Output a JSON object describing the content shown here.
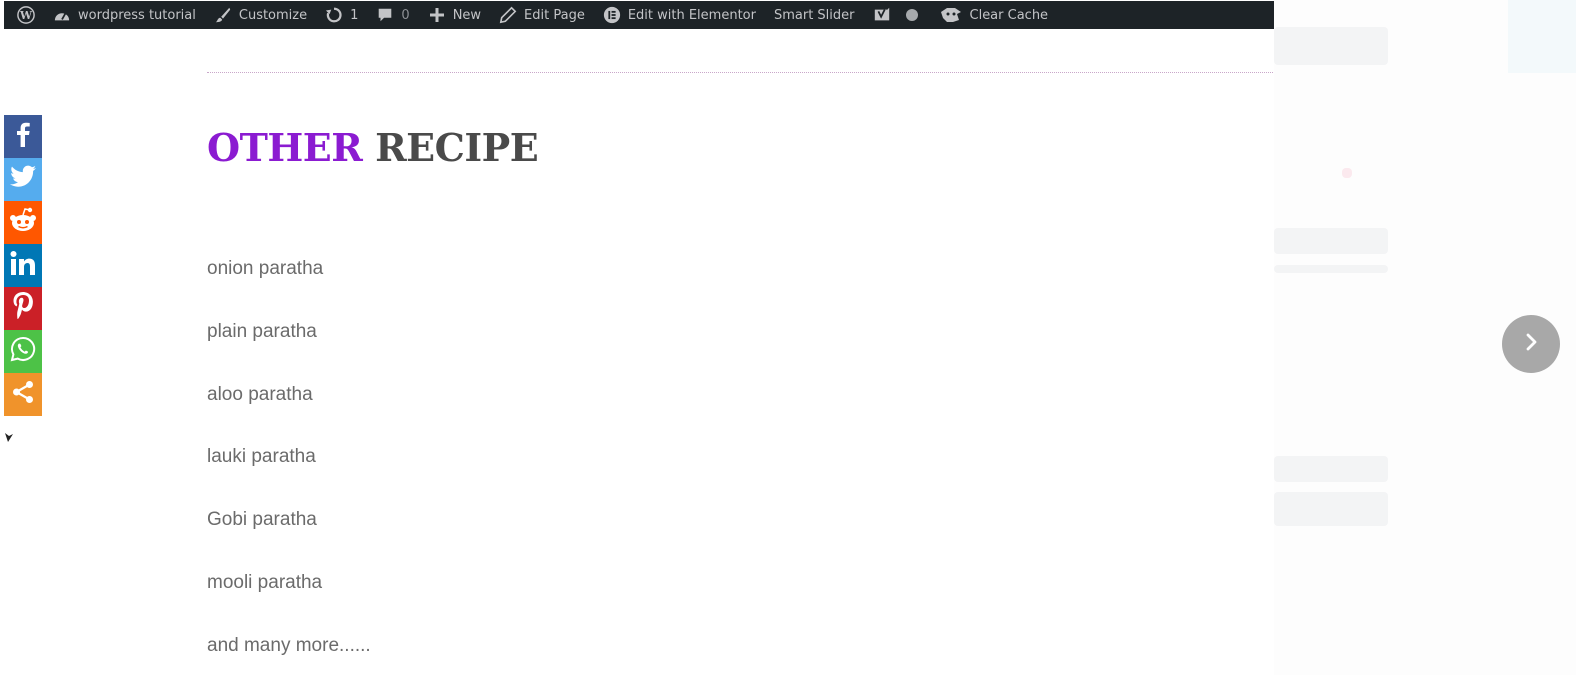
{
  "admin_bar": {
    "site_name": "wordpress tutorial",
    "customize": "Customize",
    "updates_count": "1",
    "comments_count": "0",
    "new": "New",
    "edit_page": "Edit Page",
    "edit_elementor": "Edit with Elementor",
    "smart_slider": "Smart Slider",
    "clear_cache": "Clear Cache"
  },
  "section": {
    "title_accent": "OTHER",
    "title_rest": "RECIPE"
  },
  "recipes": [
    "onion paratha",
    "plain paratha",
    "aloo paratha",
    "lauki paratha",
    "Gobi paratha",
    "mooli paratha",
    "and many more......"
  ],
  "share_buttons": [
    {
      "name": "facebook",
      "color": "#3b5998"
    },
    {
      "name": "twitter",
      "color": "#55acee"
    },
    {
      "name": "reddit",
      "color": "#ff5700"
    },
    {
      "name": "linkedin",
      "color": "#0077b5"
    },
    {
      "name": "pinterest",
      "color": "#cb2027"
    },
    {
      "name": "whatsapp",
      "color": "#4dc247"
    },
    {
      "name": "share",
      "color": "#f0932b"
    }
  ],
  "colors": {
    "admin_bar_bg": "#1d2327",
    "title_accent": "#8b1bd1",
    "title_rest": "#4a4a4a",
    "recipe_text": "#6b6b6b"
  }
}
